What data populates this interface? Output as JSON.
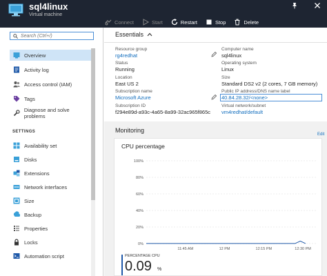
{
  "header": {
    "title": "sql4linux",
    "subtitle": "Virtual machine",
    "pin_icon": "pin-icon",
    "close_icon": "close-icon"
  },
  "toolbar": {
    "connect": "Connect",
    "start": "Start",
    "restart": "Restart",
    "stop": "Stop",
    "delete": "Delete"
  },
  "sidebar": {
    "search_placeholder": "Search (Ctrl+/)",
    "items": [
      {
        "label": "Overview",
        "icon": "overview-icon"
      },
      {
        "label": "Activity log",
        "icon": "activity-log-icon"
      },
      {
        "label": "Access control (IAM)",
        "icon": "iam-icon"
      },
      {
        "label": "Tags",
        "icon": "tag-icon"
      },
      {
        "label": "Diagnose and solve problems",
        "icon": "wrench-icon"
      }
    ],
    "settings_header": "SETTINGS",
    "settings": [
      {
        "label": "Availability set",
        "icon": "availability-set-icon"
      },
      {
        "label": "Disks",
        "icon": "disk-icon"
      },
      {
        "label": "Extensions",
        "icon": "extensions-icon"
      },
      {
        "label": "Network interfaces",
        "icon": "network-icon"
      },
      {
        "label": "Size",
        "icon": "size-icon"
      },
      {
        "label": "Backup",
        "icon": "backup-icon"
      },
      {
        "label": "Properties",
        "icon": "properties-icon"
      },
      {
        "label": "Locks",
        "icon": "lock-icon"
      },
      {
        "label": "Automation script",
        "icon": "script-icon"
      }
    ]
  },
  "essentials": {
    "title": "Essentials",
    "left": [
      {
        "label": "Resource group",
        "value": "rg4redhat"
      },
      {
        "label": "Status",
        "value": "Running"
      },
      {
        "label": "Location",
        "value": "East US 2"
      },
      {
        "label": "Subscription name",
        "value": "Microsoft Azure"
      },
      {
        "label": "Subscription ID",
        "value": "f294e89d-a93c-4a65-8a99-32ac965f865c"
      }
    ],
    "right": [
      {
        "label": "Computer name",
        "value": "sql4linux"
      },
      {
        "label": "Operating system",
        "value": "Linux"
      },
      {
        "label": "Size",
        "value": "Standard DS2 v2 (2 cores, 7 GB memory)"
      },
      {
        "label": "Public IP address/DNS name label",
        "value": "40.84.28.32/<none>"
      },
      {
        "label": "Virtual network/subnet",
        "value": "vm4redhat/default"
      }
    ]
  },
  "monitoring": {
    "title": "Monitoring",
    "card_title": "CPU percentage",
    "edit_label": "Edit",
    "gauge_label": "PERCENTAGE CPU",
    "gauge_value": "0.09",
    "gauge_unit": "%"
  },
  "chart_data": {
    "type": "line",
    "title": "CPU percentage",
    "xlabel": "",
    "ylabel": "",
    "y_ticks": [
      "0%",
      "20%",
      "40%",
      "60%",
      "80%",
      "100%"
    ],
    "x_ticks": [
      "11:45 AM",
      "12 PM",
      "12:15 PM",
      "12:30 PM"
    ],
    "ylim": [
      0,
      100
    ],
    "grid": true,
    "series": [
      {
        "name": "",
        "x": [
          "11:30 AM",
          "11:35 AM",
          "11:40 AM",
          "11:45 AM",
          "11:50 AM",
          "11:55 AM",
          "12 PM",
          "12:05 PM",
          "12:10 PM",
          "12:15 PM",
          "12:20 PM",
          "12:25 PM",
          "12:27 PM",
          "12:29 PM",
          "12:31 PM"
        ],
        "values": [
          0.1,
          0.1,
          0.1,
          0.1,
          0.1,
          0.1,
          0.1,
          0.1,
          0.1,
          0.1,
          0.1,
          0.1,
          0.1,
          3,
          0.1
        ]
      }
    ],
    "color": "#1e58a8"
  }
}
